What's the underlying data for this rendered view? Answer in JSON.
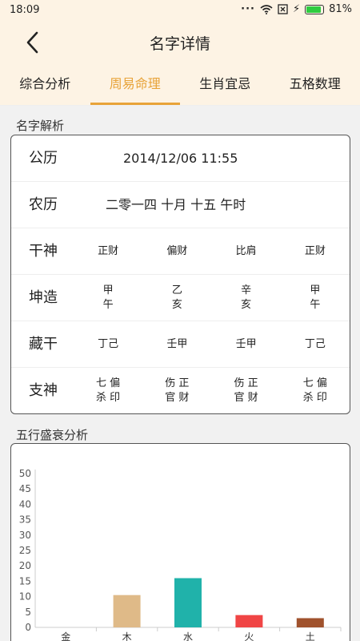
{
  "status": {
    "time": "18:09",
    "battery": "81%",
    "battery_level": 0.81
  },
  "header": {
    "title": "名字详情"
  },
  "tabs": [
    {
      "label": "综合分析"
    },
    {
      "label": "周易命理"
    },
    {
      "label": "生肖宜忌"
    },
    {
      "label": "五格数理"
    }
  ],
  "active_tab": 1,
  "analysis": {
    "title": "名字解析",
    "gongli": {
      "label": "公历",
      "value": "2014/12/06 11:55"
    },
    "nongli": {
      "label": "农历",
      "value": "二零一四 十月 十五 午时"
    },
    "gan_shen": {
      "label": "干神",
      "cols": [
        "正财",
        "偏财",
        "比肩",
        "正财"
      ]
    },
    "kun_zao": {
      "label": "坤造",
      "cols": [
        "甲\n午",
        "乙\n亥",
        "辛\n亥",
        "甲\n午"
      ]
    },
    "cang_gan": {
      "label": "藏干",
      "cols": [
        "丁己",
        "壬甲",
        "壬甲",
        "丁己"
      ]
    },
    "zhi_shen": {
      "label": "支神",
      "cols": [
        "七 偏\n杀 印",
        "伤 正\n官 财",
        "伤 正\n官 财",
        "七 偏\n杀 印"
      ]
    }
  },
  "wuxing": {
    "title": "五行盛衰分析"
  },
  "chart_data": {
    "type": "bar",
    "categories": [
      "金",
      "木",
      "水",
      "火",
      "土"
    ],
    "values": [
      0,
      10.5,
      16,
      4,
      3
    ],
    "colors": [
      "#999999",
      "#dfba88",
      "#20b2aa",
      "#f04545",
      "#a0522d"
    ],
    "ylim": [
      0,
      50
    ],
    "yticks": [
      0,
      5,
      10,
      15,
      20,
      25,
      30,
      35,
      40,
      45,
      50
    ],
    "title": "",
    "xlabel": "",
    "ylabel": ""
  }
}
